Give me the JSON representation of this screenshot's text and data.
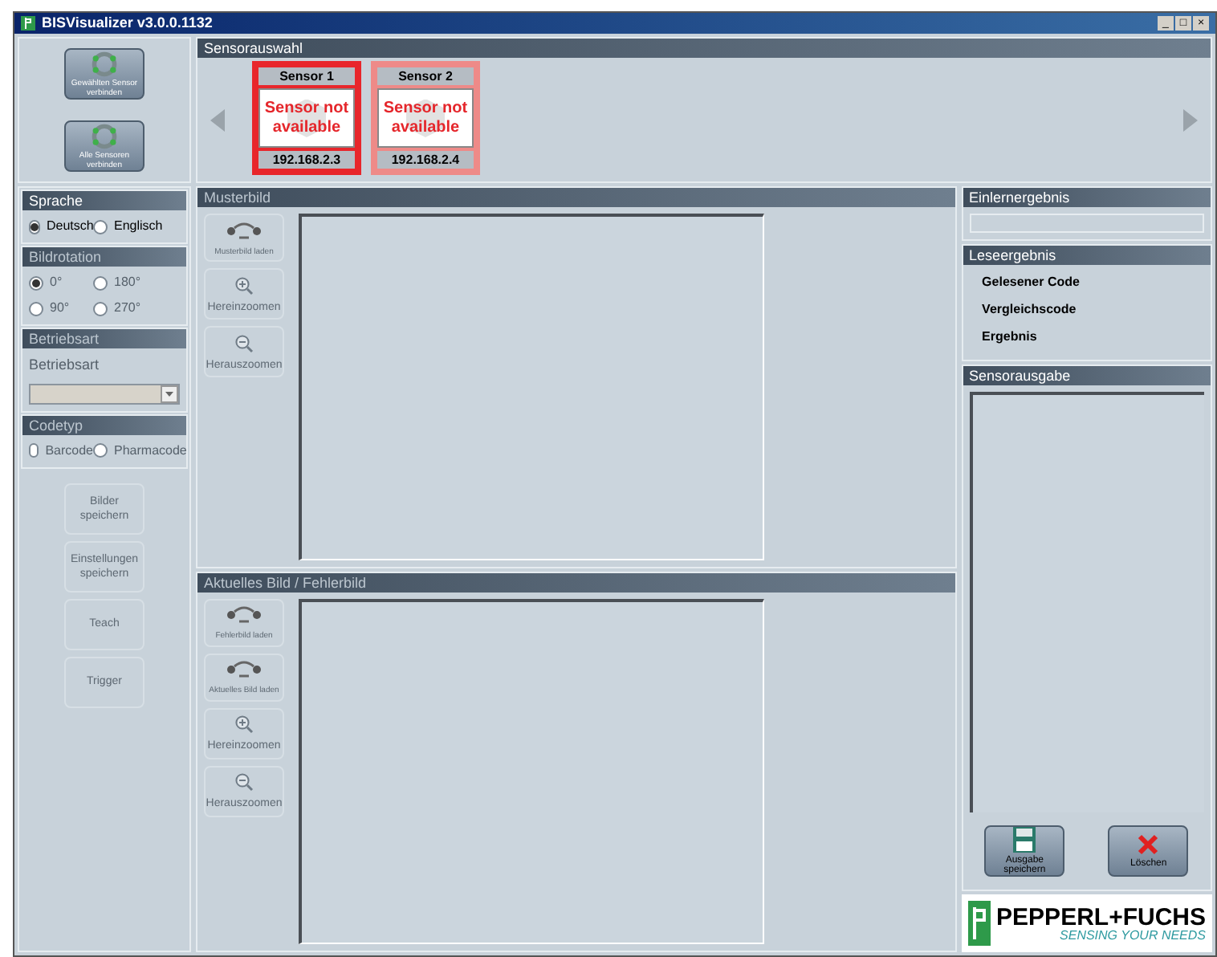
{
  "window": {
    "title": "BISVisualizer v3.0.0.1132",
    "controls": [
      "_",
      "□",
      "×"
    ]
  },
  "connect_buttons": [
    {
      "label": "Gewählten Sensor verbinden"
    },
    {
      "label": "Alle Sensoren verbinden"
    }
  ],
  "sensor_selection": {
    "title": "Sensorauswahl",
    "sensors": [
      {
        "name": "Sensor 1",
        "status": "Sensor not available",
        "ip": "192.168.2.3",
        "selected": true
      },
      {
        "name": "Sensor 2",
        "status": "Sensor not available",
        "ip": "192.168.2.4",
        "selected": false
      }
    ]
  },
  "left_panel": {
    "groups": [
      {
        "title": "Sprache",
        "disabled": false,
        "kind": "radios",
        "options": [
          {
            "label": "Deutsch",
            "selected": true
          },
          {
            "label": "Englisch",
            "selected": false
          }
        ]
      },
      {
        "title": "Bildrotation",
        "disabled": true,
        "kind": "radios",
        "options": [
          {
            "label": "0°",
            "selected": true
          },
          {
            "label": "180°",
            "selected": false
          },
          {
            "label": "90°",
            "selected": false
          },
          {
            "label": "270°",
            "selected": false
          }
        ]
      },
      {
        "title": "Betriebsart",
        "disabled": true,
        "kind": "dropdown",
        "label": "Betriebsart"
      },
      {
        "title": "Codetyp",
        "disabled": true,
        "kind": "radios",
        "options": [
          {
            "label": "Barcode",
            "selected": false
          },
          {
            "label": "Pharmacode",
            "selected": false
          }
        ]
      }
    ],
    "buttons": [
      {
        "label": "Bilder speichern",
        "disabled": true
      },
      {
        "label": "Einstellungen speichern",
        "disabled": true
      },
      {
        "label": "Teach",
        "disabled": true
      },
      {
        "label": "Trigger",
        "disabled": true
      }
    ]
  },
  "image_panels": [
    {
      "title": "Musterbild",
      "disabled": true,
      "buttons": [
        {
          "label": "Musterbild laden",
          "kind": "load"
        },
        {
          "label": "Hereinzoomen",
          "kind": "zoom-in"
        },
        {
          "label": "Herauszoomen",
          "kind": "zoom-out"
        }
      ]
    },
    {
      "title": "Aktuelles Bild / Fehlerbild",
      "disabled": true,
      "buttons": [
        {
          "label": "Fehlerbild laden",
          "kind": "load"
        },
        {
          "label": "Aktuelles Bild laden",
          "kind": "load"
        },
        {
          "label": "Hereinzoomen",
          "kind": "zoom-in"
        },
        {
          "label": "Herauszoomen",
          "kind": "zoom-out"
        }
      ]
    }
  ],
  "teach_result": {
    "title": "Einlernergebnis"
  },
  "read_result": {
    "title": "Leseergebnis",
    "rows": [
      "Gelesener Code",
      "Vergleichscode",
      "Ergebnis"
    ]
  },
  "sensor_output": {
    "title": "Sensorausgabe",
    "buttons": [
      {
        "label": "Ausgabe speichern",
        "kind": "save"
      },
      {
        "label": "Löschen",
        "kind": "delete"
      }
    ]
  },
  "logo": {
    "name": "PEPPERL+FUCHS",
    "slogan": "SENSING YOUR NEEDS"
  }
}
